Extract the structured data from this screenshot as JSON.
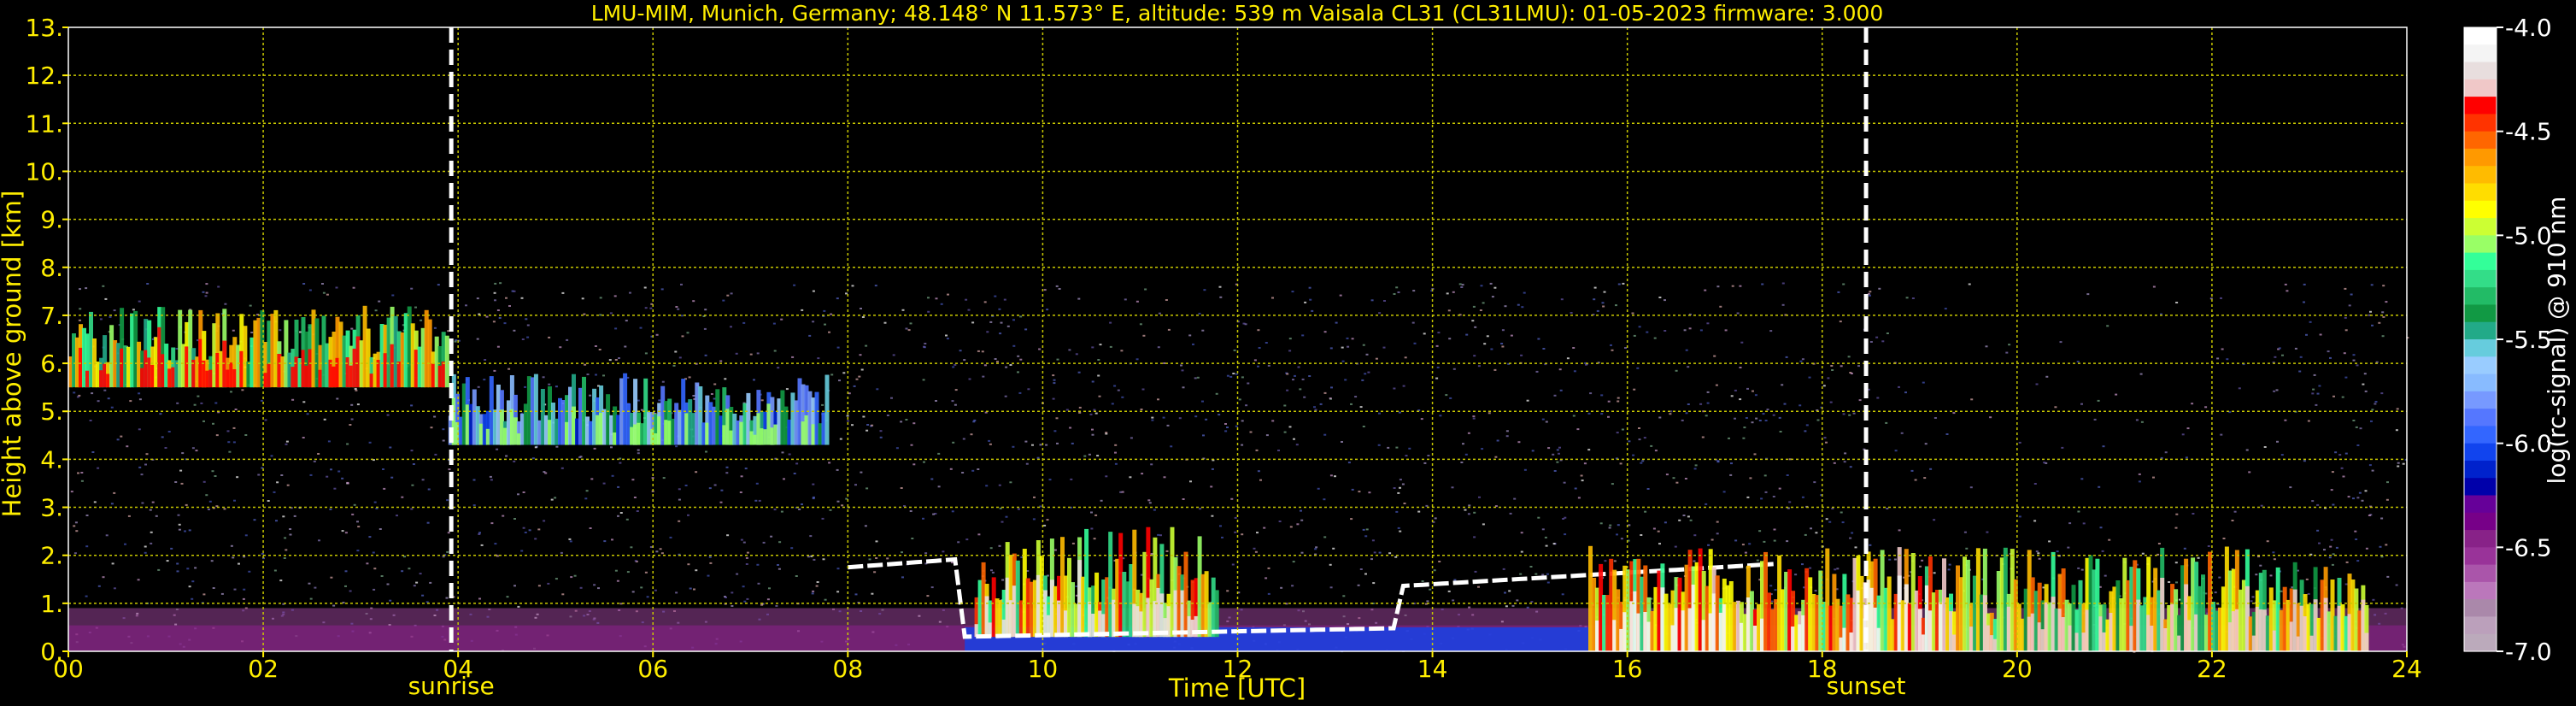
{
  "chart_data": {
    "type": "heatmap",
    "title": "LMU-MIM, Munich, Germany; 48.148° N 11.573° E, altitude: 539 m    Vaisala CL31 (CL31LMU): 01-05-2023    firmware: 3.000",
    "xlabel": "Time [UTC]",
    "ylabel": "Height above ground [km]",
    "xlim": [
      0,
      24
    ],
    "ylim": [
      0,
      13
    ],
    "x_ticks": [
      {
        "value": 0,
        "label": "00"
      },
      {
        "value": 2,
        "label": "02"
      },
      {
        "value": 4,
        "label": "04"
      },
      {
        "value": 6,
        "label": "06"
      },
      {
        "value": 8,
        "label": "08"
      },
      {
        "value": 10,
        "label": "10"
      },
      {
        "value": 12,
        "label": "12"
      },
      {
        "value": 14,
        "label": "14"
      },
      {
        "value": 16,
        "label": "16"
      },
      {
        "value": 18,
        "label": "18"
      },
      {
        "value": 20,
        "label": "20"
      },
      {
        "value": 22,
        "label": "22"
      },
      {
        "value": 24,
        "label": "24"
      }
    ],
    "y_ticks": [
      {
        "value": 0,
        "label": "0."
      },
      {
        "value": 1,
        "label": "1."
      },
      {
        "value": 2,
        "label": "2."
      },
      {
        "value": 3,
        "label": "3."
      },
      {
        "value": 4,
        "label": "4."
      },
      {
        "value": 5,
        "label": "5."
      },
      {
        "value": 6,
        "label": "6."
      },
      {
        "value": 7,
        "label": "7."
      },
      {
        "value": 8,
        "label": "8."
      },
      {
        "value": 9,
        "label": "9."
      },
      {
        "value": 10,
        "label": "10."
      },
      {
        "value": 11,
        "label": "11."
      },
      {
        "value": 12,
        "label": "12."
      },
      {
        "value": 13,
        "label": "13."
      }
    ],
    "grid": true,
    "grid_color": "#c8c800",
    "markers": [
      {
        "name": "sunrise",
        "x": 3.93,
        "label": "sunrise"
      },
      {
        "name": "sunset",
        "x": 18.45,
        "label": "sunset"
      }
    ],
    "data_top_km": 7.7,
    "colorbar": {
      "label": "log(rc-signal) @ 910 nm",
      "range": [
        -7.0,
        -4.0
      ],
      "ticks": [
        {
          "value": -4.0,
          "label": "-4.0"
        },
        {
          "value": -4.5,
          "label": "-4.5"
        },
        {
          "value": -5.0,
          "label": "-5.0"
        },
        {
          "value": -5.5,
          "label": "-5.5"
        },
        {
          "value": -6.0,
          "label": "-6.0"
        },
        {
          "value": -6.5,
          "label": "-6.5"
        },
        {
          "value": -7.0,
          "label": "-7.0"
        }
      ],
      "colors_top_to_bottom": [
        "#ffffff",
        "#f4f4f4",
        "#e8dede",
        "#f0c8c8",
        "#ff0000",
        "#ff3300",
        "#ff6600",
        "#ff9900",
        "#ffbb00",
        "#ffdd00",
        "#ffff00",
        "#ccff33",
        "#99ff66",
        "#33ff99",
        "#33dd88",
        "#22bb66",
        "#119944",
        "#22aa88",
        "#66ccdd",
        "#99ccff",
        "#88bbff",
        "#7799ff",
        "#5577ff",
        "#3366ff",
        "#1144ee",
        "#0022cc",
        "#0000aa",
        "#660099",
        "#770088",
        "#882288",
        "#993399",
        "#aa55aa",
        "#bb77bb",
        "#aa88aa",
        "#bba0bb",
        "#bbaabb"
      ]
    },
    "features": [
      {
        "name": "cirrus-layer",
        "t": [
          0.0,
          3.9
        ],
        "h": [
          5.5,
          7.2
        ],
        "level": -4.6
      },
      {
        "name": "descending-cloud",
        "t": [
          3.9,
          7.8
        ],
        "h": [
          4.3,
          5.8
        ],
        "level": -5.2
      },
      {
        "name": "boundary-layer",
        "t": [
          0,
          24
        ],
        "h": [
          0,
          0.9
        ],
        "level": -6.4
      },
      {
        "name": "convective-clouds-morning",
        "t": [
          9.3,
          11.8
        ],
        "h": [
          0.3,
          2.6
        ],
        "level": -4.4
      },
      {
        "name": "cloud-base-line",
        "t": [
          8.0,
          17.5
        ],
        "h": [
          1.7,
          2.0
        ],
        "level": -4.0
      },
      {
        "name": "convective-clouds-afternoon",
        "t": [
          15.6,
          19.3
        ],
        "h": [
          0.0,
          2.2
        ],
        "level": -4.3
      },
      {
        "name": "evening-clouds",
        "t": [
          19.3,
          23.6
        ],
        "h": [
          0.0,
          2.2
        ],
        "level": -4.5
      }
    ]
  }
}
